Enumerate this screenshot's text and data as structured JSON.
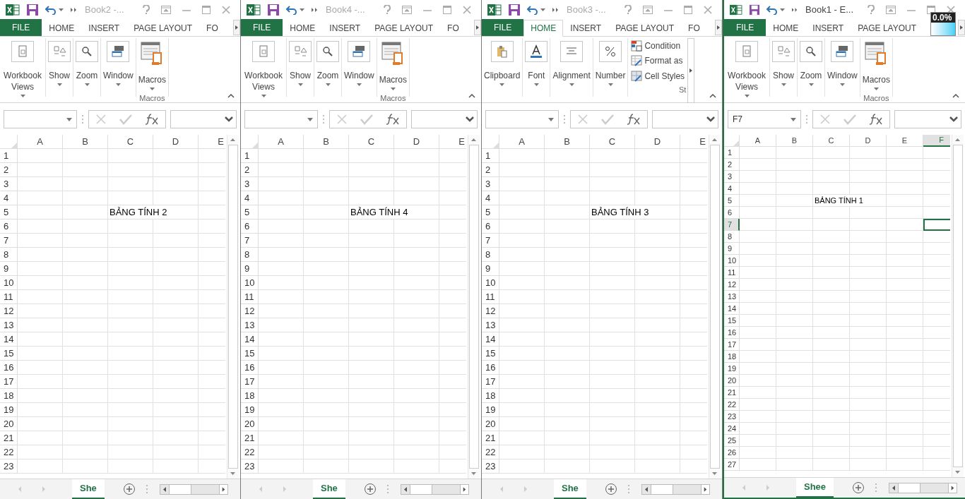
{
  "windows": [
    {
      "title": "Book2 -...",
      "active": false,
      "tabs": [
        {
          "label": "FILE",
          "kind": "file",
          "selected": false
        },
        {
          "label": "HOME",
          "kind": "tab",
          "selected": false
        },
        {
          "label": "INSERT",
          "kind": "tab",
          "selected": false
        },
        {
          "label": "PAGE LAYOUT",
          "kind": "tab",
          "selected": false
        },
        {
          "label": "FO",
          "kind": "tab",
          "selected": false
        }
      ],
      "ribbon": {
        "kind": "view",
        "buttons": [
          {
            "label": "Workbook Views"
          },
          {
            "label": "Show"
          },
          {
            "label": "Zoom"
          },
          {
            "label": "Window"
          },
          {
            "label": "Macros",
            "caption": "Macros"
          }
        ]
      },
      "columns": [
        {
          "label": "A",
          "selected": false
        },
        {
          "label": "B",
          "selected": false
        },
        {
          "label": "C",
          "selected": false
        },
        {
          "label": "D",
          "selected": false
        },
        {
          "label": "E",
          "selected": false
        }
      ],
      "rows": [
        {
          "label": "1",
          "selected": false
        },
        {
          "label": "2",
          "selected": false
        },
        {
          "label": "3",
          "selected": false
        },
        {
          "label": "4",
          "selected": false
        },
        {
          "label": "5",
          "selected": false,
          "column_c": "BẢNG TÍNH 2"
        },
        {
          "label": "6",
          "selected": false
        },
        {
          "label": "7",
          "selected": false
        },
        {
          "label": "8",
          "selected": false
        },
        {
          "label": "9",
          "selected": false
        },
        {
          "label": "10",
          "selected": false
        },
        {
          "label": "11",
          "selected": false
        },
        {
          "label": "12",
          "selected": false
        },
        {
          "label": "13",
          "selected": false
        },
        {
          "label": "14",
          "selected": false
        },
        {
          "label": "15",
          "selected": false
        },
        {
          "label": "16",
          "selected": false
        },
        {
          "label": "17",
          "selected": false
        },
        {
          "label": "18",
          "selected": false
        },
        {
          "label": "19",
          "selected": false
        },
        {
          "label": "20",
          "selected": false
        },
        {
          "label": "21",
          "selected": false
        },
        {
          "label": "22",
          "selected": false
        },
        {
          "label": "23",
          "selected": false
        }
      ],
      "sheet_tab": {
        "label": "She",
        "selected": true
      }
    },
    {
      "title": "Book4 -...",
      "active": false,
      "tabs": [
        {
          "label": "FILE",
          "kind": "file",
          "selected": false
        },
        {
          "label": "HOME",
          "kind": "tab",
          "selected": false
        },
        {
          "label": "INSERT",
          "kind": "tab",
          "selected": false
        },
        {
          "label": "PAGE LAYOUT",
          "kind": "tab",
          "selected": false
        },
        {
          "label": "FO",
          "kind": "tab",
          "selected": false
        }
      ],
      "ribbon": {
        "kind": "view",
        "buttons": [
          {
            "label": "Workbook Views"
          },
          {
            "label": "Show"
          },
          {
            "label": "Zoom"
          },
          {
            "label": "Window"
          },
          {
            "label": "Macros",
            "caption": "Macros"
          }
        ]
      },
      "columns": [
        {
          "label": "A",
          "selected": false
        },
        {
          "label": "B",
          "selected": false
        },
        {
          "label": "C",
          "selected": false
        },
        {
          "label": "D",
          "selected": false
        },
        {
          "label": "E",
          "selected": false
        }
      ],
      "rows": [
        {
          "label": "1",
          "selected": false
        },
        {
          "label": "2",
          "selected": false
        },
        {
          "label": "3",
          "selected": false
        },
        {
          "label": "4",
          "selected": false
        },
        {
          "label": "5",
          "selected": false,
          "column_c": "BẢNG TÍNH 4"
        },
        {
          "label": "6",
          "selected": false
        },
        {
          "label": "7",
          "selected": false
        },
        {
          "label": "8",
          "selected": false
        },
        {
          "label": "9",
          "selected": false
        },
        {
          "label": "10",
          "selected": false
        },
        {
          "label": "11",
          "selected": false
        },
        {
          "label": "12",
          "selected": false
        },
        {
          "label": "13",
          "selected": false
        },
        {
          "label": "14",
          "selected": false
        },
        {
          "label": "15",
          "selected": false
        },
        {
          "label": "16",
          "selected": false
        },
        {
          "label": "17",
          "selected": false
        },
        {
          "label": "18",
          "selected": false
        },
        {
          "label": "19",
          "selected": false
        },
        {
          "label": "20",
          "selected": false
        },
        {
          "label": "21",
          "selected": false
        },
        {
          "label": "22",
          "selected": false
        },
        {
          "label": "23",
          "selected": false
        }
      ],
      "sheet_tab": {
        "label": "She",
        "selected": true
      }
    },
    {
      "title": "Book3 -...",
      "active": false,
      "tabs": [
        {
          "label": "FILE",
          "kind": "file",
          "selected": false
        },
        {
          "label": "HOME",
          "kind": "tab",
          "selected": true
        },
        {
          "label": "INSERT",
          "kind": "tab",
          "selected": false
        },
        {
          "label": "PAGE LAYOUT",
          "kind": "tab",
          "selected": false
        },
        {
          "label": "FO",
          "kind": "tab",
          "selected": false
        }
      ],
      "ribbon": {
        "kind": "home",
        "buttons": [
          {
            "label": "Clipboard"
          },
          {
            "label": "Font"
          },
          {
            "label": "Alignment"
          },
          {
            "label": "Number"
          }
        ],
        "styles": [
          {
            "label": "Condition"
          },
          {
            "label": "Format as"
          },
          {
            "label": "Cell Styles"
          }
        ],
        "styles_caption": "St"
      },
      "columns": [
        {
          "label": "A",
          "selected": false
        },
        {
          "label": "B",
          "selected": false
        },
        {
          "label": "C",
          "selected": false
        },
        {
          "label": "D",
          "selected": false
        },
        {
          "label": "E",
          "selected": false
        }
      ],
      "rows": [
        {
          "label": "1",
          "selected": false
        },
        {
          "label": "2",
          "selected": false
        },
        {
          "label": "3",
          "selected": false
        },
        {
          "label": "4",
          "selected": false
        },
        {
          "label": "5",
          "selected": false,
          "column_c": "BẢNG TÍNH 3"
        },
        {
          "label": "6",
          "selected": false
        },
        {
          "label": "7",
          "selected": false
        },
        {
          "label": "8",
          "selected": false
        },
        {
          "label": "9",
          "selected": false
        },
        {
          "label": "10",
          "selected": false
        },
        {
          "label": "11",
          "selected": false
        },
        {
          "label": "12",
          "selected": false
        },
        {
          "label": "13",
          "selected": false
        },
        {
          "label": "14",
          "selected": false
        },
        {
          "label": "15",
          "selected": false
        },
        {
          "label": "16",
          "selected": false
        },
        {
          "label": "17",
          "selected": false
        },
        {
          "label": "18",
          "selected": false
        },
        {
          "label": "19",
          "selected": false
        },
        {
          "label": "20",
          "selected": false
        },
        {
          "label": "21",
          "selected": false
        },
        {
          "label": "22",
          "selected": false
        },
        {
          "label": "23",
          "selected": false
        }
      ],
      "sheet_tab": {
        "label": "She",
        "selected": true
      }
    },
    {
      "title": "Book1 - E...",
      "active": true,
      "overlay_badge": "0.0%",
      "tabs": [
        {
          "label": "FILE",
          "kind": "file",
          "selected": false
        },
        {
          "label": "HOME",
          "kind": "tab",
          "selected": false
        },
        {
          "label": "INSERT",
          "kind": "tab",
          "selected": false
        },
        {
          "label": "PAGE LAYOUT",
          "kind": "tab",
          "selected": false
        }
      ],
      "ribbon": {
        "kind": "view",
        "buttons": [
          {
            "label": "Workbook Views"
          },
          {
            "label": "Show"
          },
          {
            "label": "Zoom"
          },
          {
            "label": "Window"
          },
          {
            "label": "Macros",
            "caption": "Macros"
          }
        ]
      },
      "name_box": "F7",
      "columns": [
        {
          "label": "A",
          "selected": false
        },
        {
          "label": "B",
          "selected": false
        },
        {
          "label": "C",
          "selected": false
        },
        {
          "label": "D",
          "selected": false
        },
        {
          "label": "E",
          "selected": false
        },
        {
          "label": "F",
          "selected": true
        }
      ],
      "rows": [
        {
          "label": "1",
          "selected": false
        },
        {
          "label": "2",
          "selected": false
        },
        {
          "label": "3",
          "selected": false
        },
        {
          "label": "4",
          "selected": false
        },
        {
          "label": "5",
          "selected": false,
          "column_c": "BẢNG TÍNH 1"
        },
        {
          "label": "6",
          "selected": false
        },
        {
          "label": "7",
          "selected": true
        },
        {
          "label": "8",
          "selected": false
        },
        {
          "label": "9",
          "selected": false
        },
        {
          "label": "10",
          "selected": false
        },
        {
          "label": "11",
          "selected": false
        },
        {
          "label": "12",
          "selected": false
        },
        {
          "label": "13",
          "selected": false
        },
        {
          "label": "14",
          "selected": false
        },
        {
          "label": "15",
          "selected": false
        },
        {
          "label": "16",
          "selected": false
        },
        {
          "label": "17",
          "selected": false
        },
        {
          "label": "18",
          "selected": false
        },
        {
          "label": "19",
          "selected": false
        },
        {
          "label": "20",
          "selected": false
        },
        {
          "label": "21",
          "selected": false
        },
        {
          "label": "22",
          "selected": false
        },
        {
          "label": "23",
          "selected": false
        },
        {
          "label": "24",
          "selected": false
        },
        {
          "label": "25",
          "selected": false
        },
        {
          "label": "26",
          "selected": false
        },
        {
          "label": "27",
          "selected": false
        }
      ],
      "sheet_tab": {
        "label": "Shee",
        "selected": true
      }
    }
  ]
}
